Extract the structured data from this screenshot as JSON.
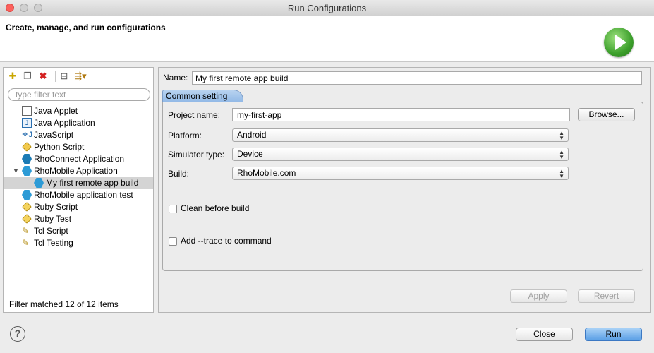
{
  "window": {
    "title": "Run Configurations"
  },
  "header": {
    "text": "Create, manage, and run configurations"
  },
  "left": {
    "filter_placeholder": "type filter text",
    "items": [
      {
        "label": "Java Applet",
        "icon": "java-applet-icon"
      },
      {
        "label": "Java Application",
        "icon": "java-application-icon"
      },
      {
        "label": "JavaScript",
        "icon": "javascript-icon"
      },
      {
        "label": "Python Script",
        "icon": "python-script-icon"
      },
      {
        "label": "RhoConnect Application",
        "icon": "rhoconnect-icon"
      },
      {
        "label": "RhoMobile Application",
        "icon": "rhomobile-icon",
        "expanded": true
      },
      {
        "label": "My first remote app build",
        "icon": "rhomobile-icon",
        "selected": true
      },
      {
        "label": "RhoMobile application test",
        "icon": "rhomobile-icon"
      },
      {
        "label": "Ruby Script",
        "icon": "ruby-script-icon"
      },
      {
        "label": "Ruby Test",
        "icon": "ruby-test-icon"
      },
      {
        "label": "Tcl Script",
        "icon": "tcl-script-icon"
      },
      {
        "label": "Tcl Testing",
        "icon": "tcl-testing-icon"
      }
    ],
    "status": "Filter matched 12 of 12 items"
  },
  "right": {
    "name_label": "Name:",
    "name_value": "My first remote app build",
    "tab": "Common setting",
    "project_label": "Project name:",
    "project_value": "my-first-app",
    "browse_label": "Browse...",
    "platform_label": "Platform:",
    "platform_value": "Android",
    "simulator_label": "Simulator type:",
    "simulator_value": "Device",
    "build_label": "Build:",
    "build_value": "RhoMobile.com",
    "clean_label": "Clean before build",
    "trace_label": "Add --trace to command",
    "apply_label": "Apply",
    "revert_label": "Revert"
  },
  "footer": {
    "help": "?",
    "close_label": "Close",
    "run_label": "Run"
  },
  "colors": {
    "accent": "#5a9fe6",
    "tab": "#a8c8ee",
    "run_icon": "#3c9f2b"
  }
}
